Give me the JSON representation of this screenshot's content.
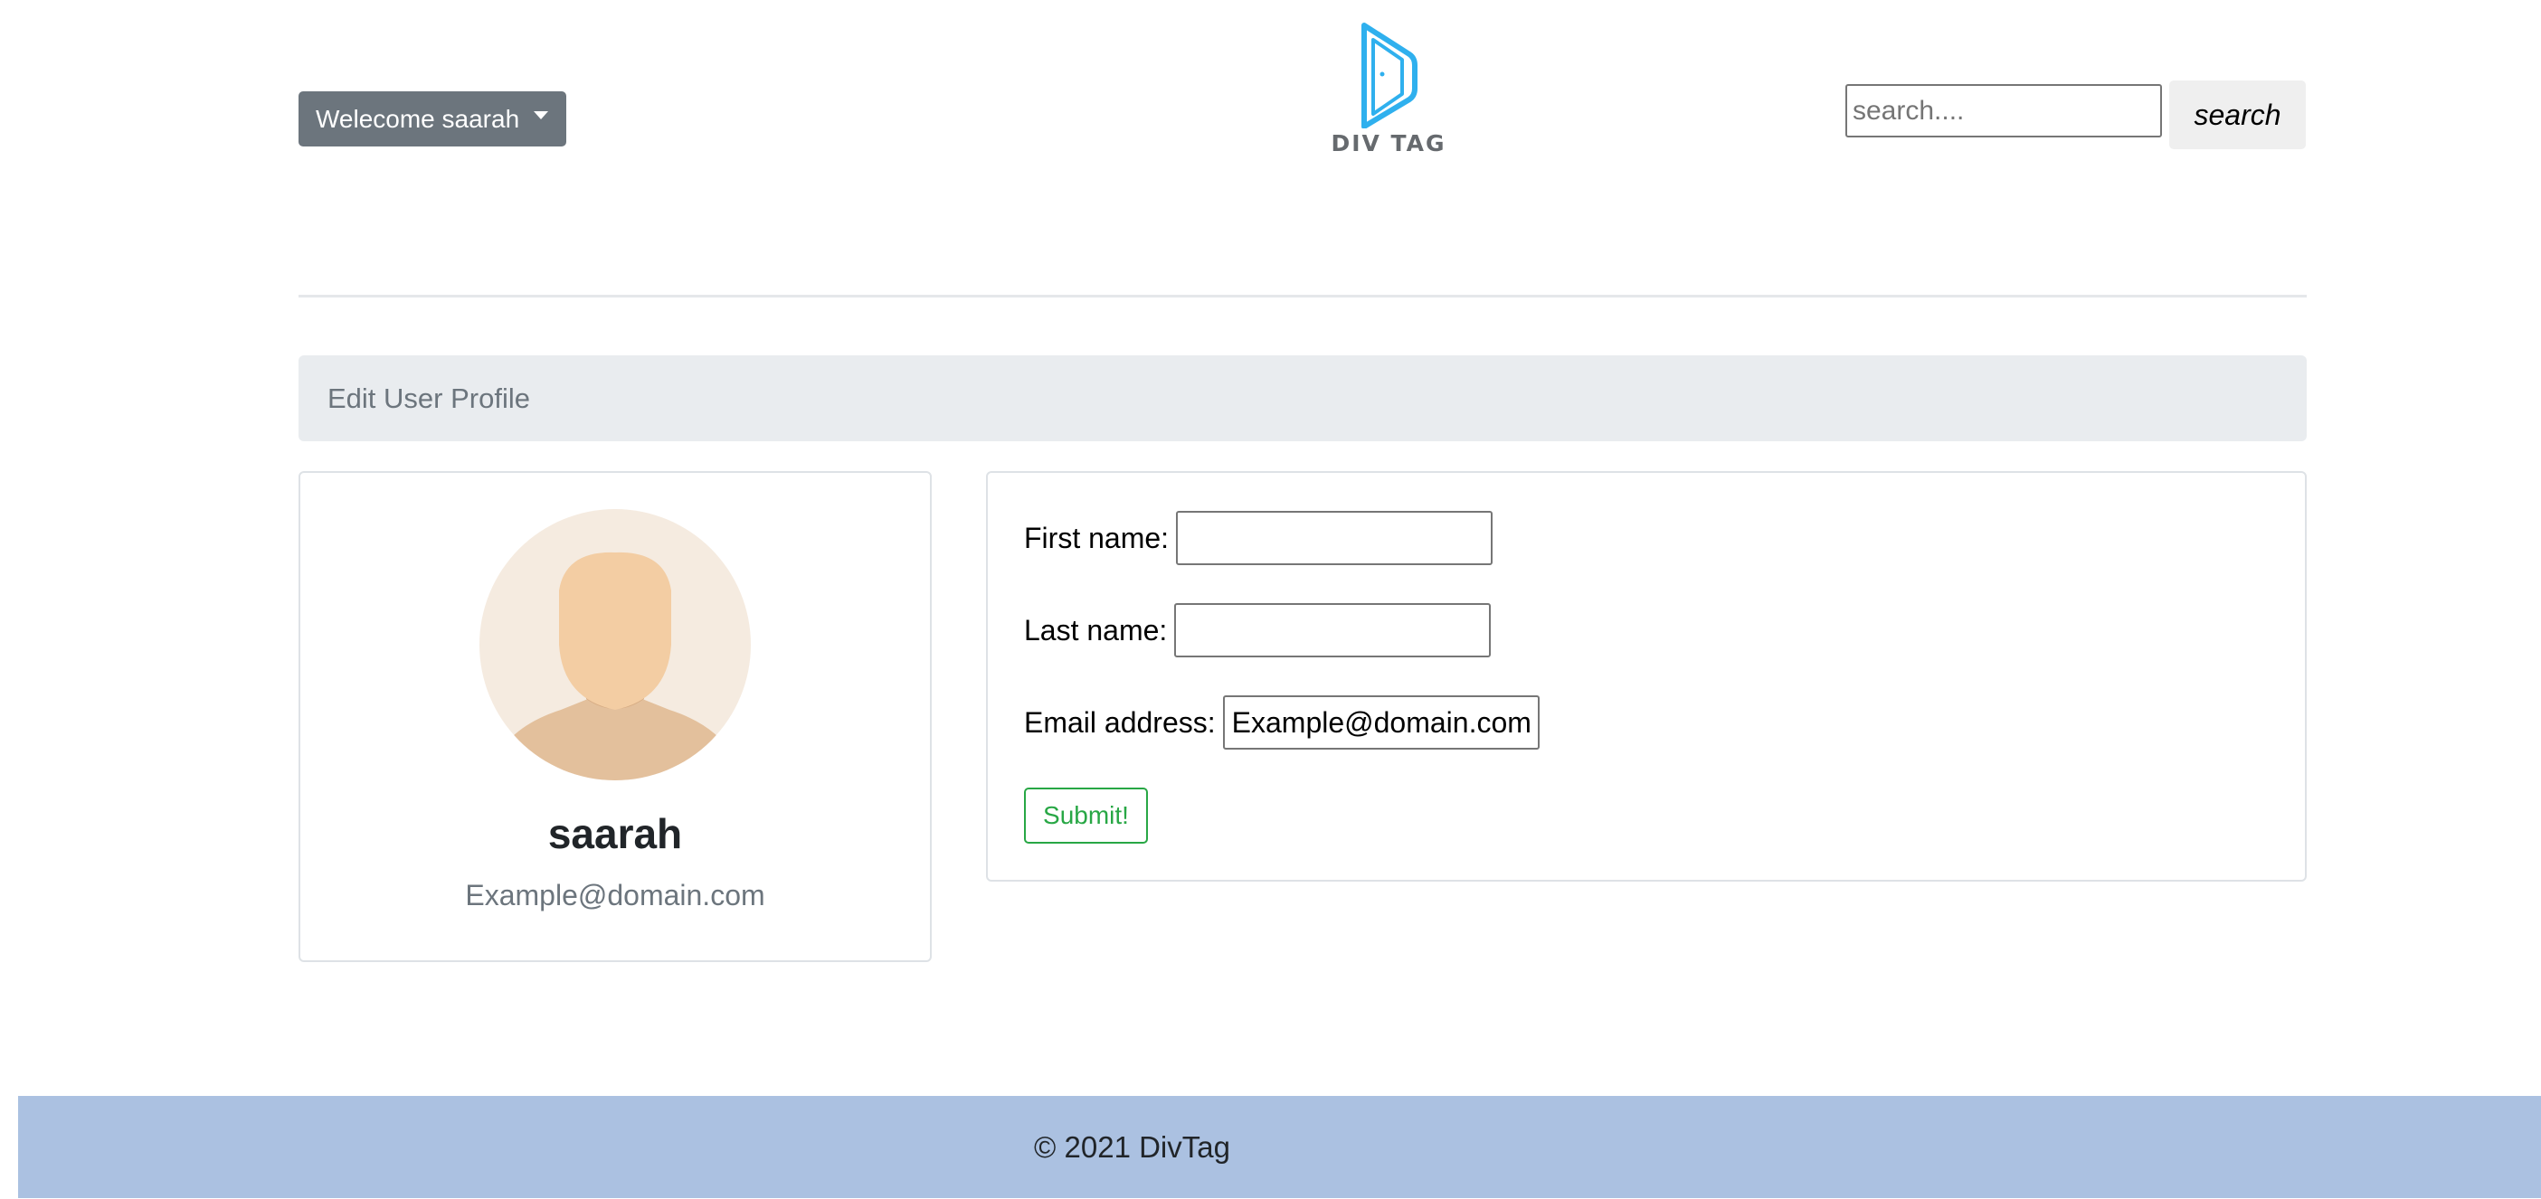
{
  "header": {
    "welcome_label": "Welecome saarah",
    "logo_text": "DIV TAG",
    "search": {
      "placeholder": "search....",
      "value": "",
      "button_label": "search"
    }
  },
  "breadcrumb": {
    "title": "Edit User Profile"
  },
  "profile": {
    "name": "saarah",
    "email": "Example@domain.com"
  },
  "form": {
    "first_name_label": "First name:",
    "first_name_value": "",
    "last_name_label": "Last name:",
    "last_name_value": "",
    "email_label": "Email address:",
    "email_value": "Example@domain.com",
    "submit_label": "Submit!"
  },
  "footer": {
    "copyright": "© 2021 DivTag"
  },
  "colors": {
    "welcome_button_bg": "#6c757d",
    "logo_blue": "#2fb0ee",
    "breadcrumb_bg": "#e9ecef",
    "submit_green": "#28a745",
    "footer_bg": "#abc1e1",
    "avatar_bg": "#f5ebe0",
    "avatar_skin": "#f3cda3",
    "avatar_shoulders": "#e3c09c"
  }
}
